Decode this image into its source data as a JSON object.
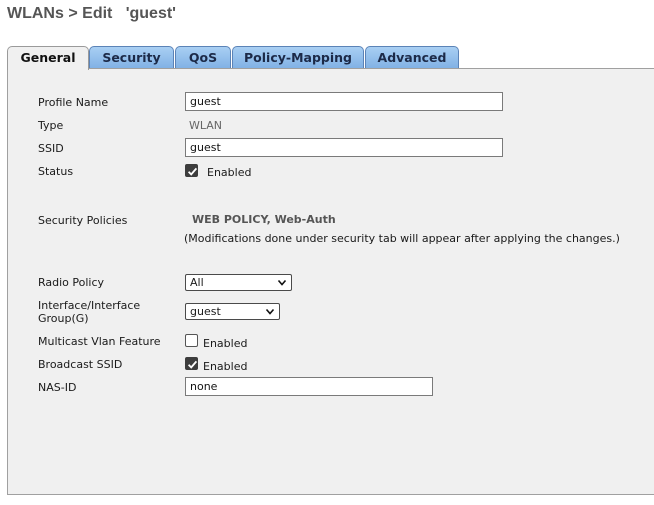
{
  "breadcrumb": {
    "section": "WLANs",
    "separator": ">",
    "action": "Edit",
    "profile": "'guest'"
  },
  "tabs": [
    {
      "label": "General",
      "active": true
    },
    {
      "label": "Security",
      "active": false
    },
    {
      "label": "QoS",
      "active": false
    },
    {
      "label": "Policy-Mapping",
      "active": false
    },
    {
      "label": "Advanced",
      "active": false
    }
  ],
  "form": {
    "profile_name": {
      "label": "Profile Name",
      "value": "guest"
    },
    "type": {
      "label": "Type",
      "value": "WLAN"
    },
    "ssid": {
      "label": "SSID",
      "value": "guest"
    },
    "status": {
      "label": "Status",
      "checked": true,
      "option_label": "Enabled"
    },
    "security_policies": {
      "label": "Security Policies",
      "value": "WEB POLICY, Web-Auth",
      "note": "(Modifications done under security tab will appear after applying the changes.)"
    },
    "radio_policy": {
      "label": "Radio Policy",
      "selected": "All"
    },
    "interface": {
      "label_line1": "Interface/Interface",
      "label_line2": "Group(G)",
      "selected": "guest"
    },
    "multicast_vlan": {
      "label": "Multicast Vlan Feature",
      "checked": false,
      "option_label": "Enabled"
    },
    "broadcast_ssid": {
      "label": "Broadcast SSID",
      "checked": true,
      "option_label": "Enabled"
    },
    "nas_id": {
      "label": "NAS-ID",
      "value": "none"
    }
  },
  "colors": {
    "tab_bg": "#7fb0e4",
    "active_tab_bg": "#f0f0f0",
    "panel_bg": "#f0f0f0",
    "title_text": "#555555"
  },
  "icons": {
    "select_arrow": "chevron-down-icon",
    "checkbox_mark": "checkmark-icon"
  }
}
